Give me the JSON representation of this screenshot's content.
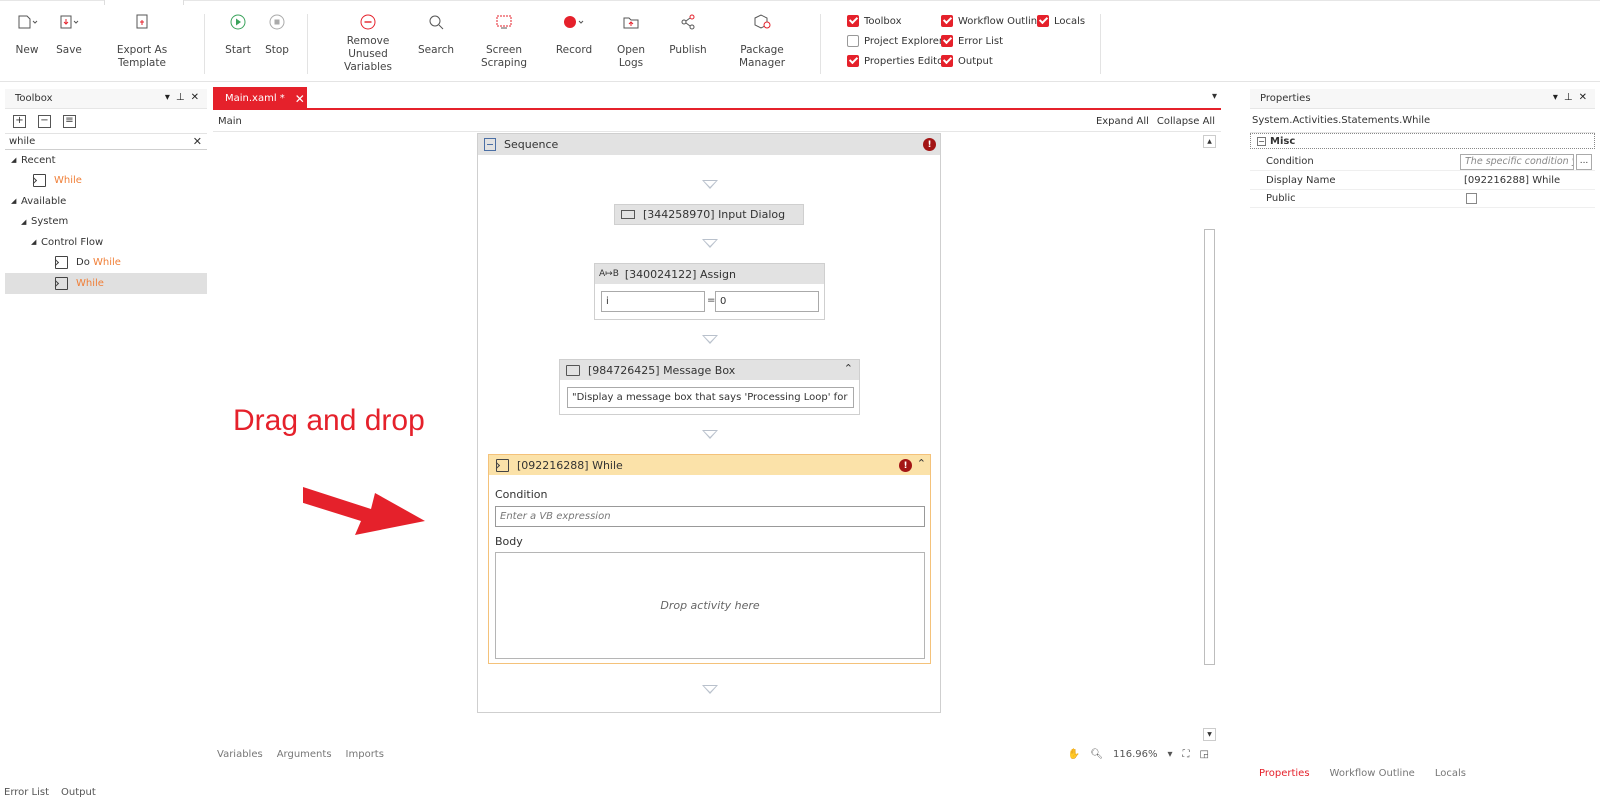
{
  "ribbon": {
    "buttons": [
      {
        "id": "new",
        "label": "New"
      },
      {
        "id": "save",
        "label": "Save"
      },
      {
        "id": "export",
        "label": "Export As Template"
      },
      {
        "id": "start",
        "label": "Start"
      },
      {
        "id": "stop",
        "label": "Stop"
      },
      {
        "id": "remove",
        "label": "Remove Unused Variables",
        "line1": "Remove Unused",
        "line2": "Variables"
      },
      {
        "id": "search",
        "label": "Search"
      },
      {
        "id": "scraping",
        "label": "Screen Scraping"
      },
      {
        "id": "record",
        "label": "Record"
      },
      {
        "id": "logs",
        "label": "Open Logs"
      },
      {
        "id": "publish",
        "label": "Publish"
      },
      {
        "id": "pkg",
        "label": "Package Manager"
      }
    ],
    "checks": [
      {
        "label": "Toolbox",
        "checked": true
      },
      {
        "label": "Project Explorer",
        "checked": false
      },
      {
        "label": "Properties Editor",
        "checked": true
      },
      {
        "label": "Workflow Outline",
        "checked": true
      },
      {
        "label": "Error List",
        "checked": true
      },
      {
        "label": "Output",
        "checked": true
      },
      {
        "label": "Locals",
        "checked": true
      }
    ]
  },
  "toolbox": {
    "title": "Toolbox",
    "search_value": "while",
    "tree": {
      "recent": "Recent",
      "recent_item": "While",
      "available": "Available",
      "system": "System",
      "control_flow": "Control Flow",
      "do_prefix": "Do",
      "do_while_suffix": "While",
      "while_item": "While"
    }
  },
  "designer": {
    "tab_label": "Main.xaml *",
    "breadcrumb": "Main",
    "expand_all": "Expand All",
    "collapse_all": "Collapse All",
    "sequence_title": "Sequence",
    "input_dialog": "[344258970] Input Dialog",
    "assign_title": "[340024122] Assign",
    "assign_left": "i",
    "assign_eq": "=",
    "assign_right": "0",
    "msgbox_title": "[984726425] Message Box",
    "msgbox_text": "\"Display a message box that says 'Processing Loop' for",
    "while_title": "[092216288] While",
    "condition_label": "Condition",
    "condition_placeholder": "Enter a VB expression",
    "body_label": "Body",
    "drop_here": "Drop activity here",
    "bottom_tabs": [
      "Variables",
      "Arguments",
      "Imports"
    ],
    "zoom": "116.96%"
  },
  "annotation": {
    "text": "Drag and drop",
    "color": "#e5212b"
  },
  "properties": {
    "title": "Properties",
    "type": "System.Activities.Statements.While",
    "category": "Misc",
    "rows": [
      {
        "key": "Condition",
        "value": "The specific condition yo"
      },
      {
        "key": "Display Name",
        "value": "[092216288] While"
      },
      {
        "key": "Public",
        "value": ""
      }
    ],
    "bottom_tabs": [
      "Properties",
      "Workflow Outline",
      "Locals"
    ]
  },
  "status": {
    "tabs": [
      "Error List",
      "Output"
    ]
  },
  "colors": {
    "accent": "#e5212b",
    "highlight": "#f07f38",
    "while_header": "#fbe2a9"
  }
}
